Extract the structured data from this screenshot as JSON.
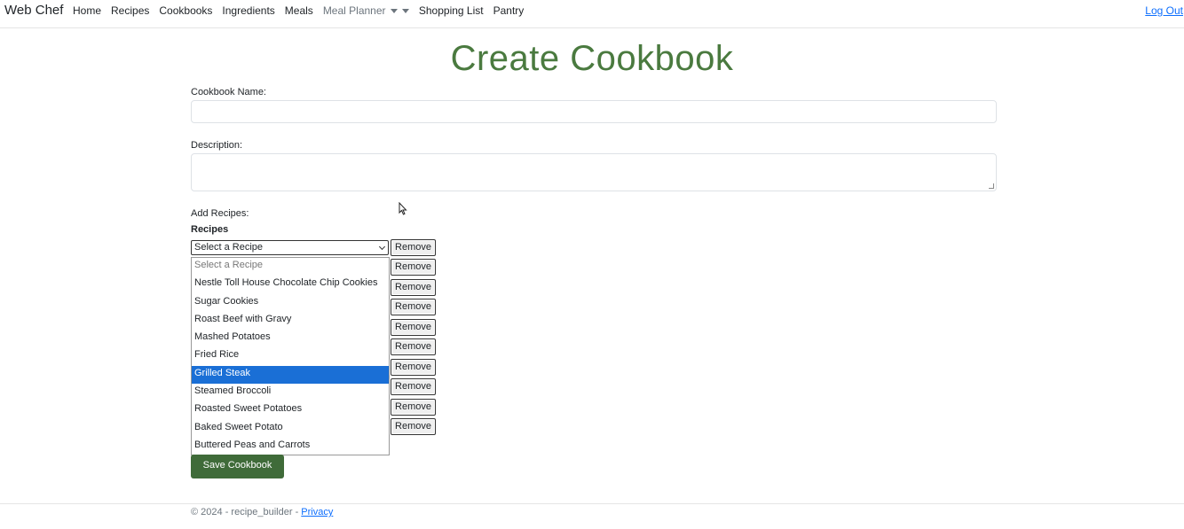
{
  "nav": {
    "brand": "Web Chef",
    "items": [
      "Home",
      "Recipes",
      "Cookbooks",
      "Ingredients",
      "Meals"
    ],
    "meal_planner": "Meal Planner",
    "items_after": [
      "Shopping List",
      "Pantry"
    ],
    "logout": "Log Out"
  },
  "page": {
    "title": "Create Cookbook",
    "cookbook_name_label": "Cookbook Name:",
    "cookbook_name_value": "",
    "description_label": "Description:",
    "description_value": "",
    "add_recipes_label": "Add Recipes:",
    "recipes_heading": "Recipes",
    "select_value": "Select a Recipe",
    "dropdown_options": [
      "Select a Recipe",
      "Nestle Toll House Chocolate Chip Cookies",
      "Sugar Cookies",
      "Roast Beef with Gravy",
      "Mashed Potatoes",
      "Fried Rice",
      "Grilled Steak",
      "Steamed Broccoli",
      "Roasted Sweet Potatoes",
      "Baked Sweet Potato",
      "Buttered Peas and Carrots"
    ],
    "highlighted_option": "Grilled Steak",
    "remove_label": "Remove",
    "remove_count": 10,
    "save_label": "Save Cookbook"
  },
  "footer": {
    "text": "© 2024 - recipe_builder - ",
    "privacy": "Privacy"
  },
  "colors": {
    "accent_green": "#4a7a3f",
    "button_green": "#3f6b39",
    "link_blue": "#0d6efd",
    "highlight_blue": "#1a6fd6"
  }
}
